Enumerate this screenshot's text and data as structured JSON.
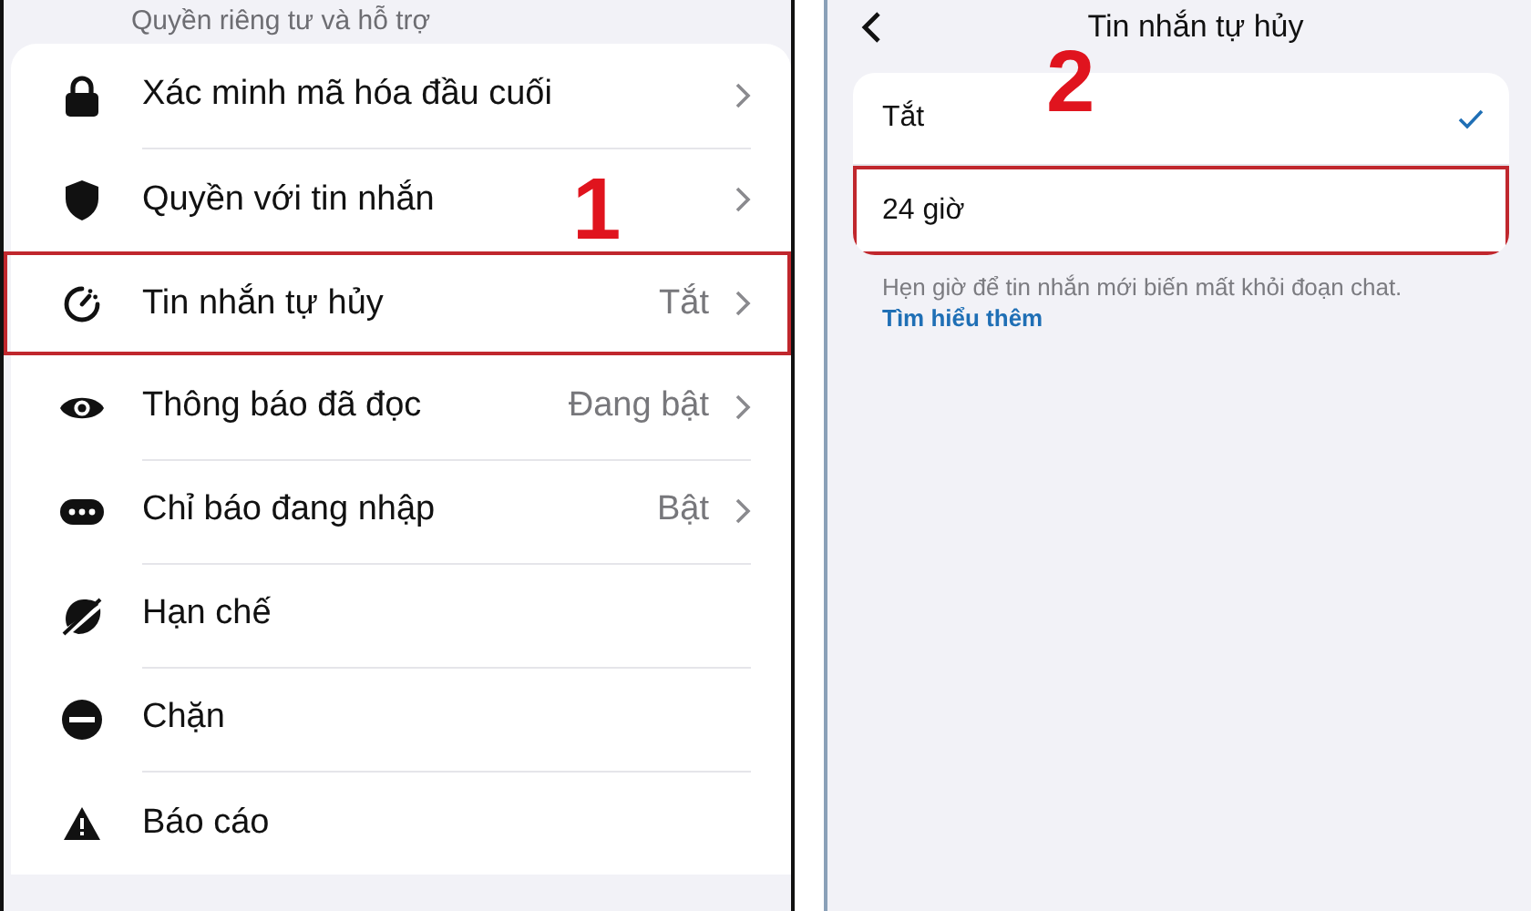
{
  "settings_screen": {
    "section_title": "Quyền riêng tư và hỗ trợ",
    "items": [
      {
        "kind": "lock",
        "label": "Xác minh mã hóa đầu cuối",
        "chevron": true,
        "highlighted": false
      },
      {
        "kind": "shield",
        "label": "Quyền với tin nhắn",
        "chevron": true,
        "highlighted": false
      },
      {
        "kind": "timer",
        "label": "Tin nhắn tự hủy",
        "value": "Tắt",
        "chevron": true,
        "highlighted": true
      },
      {
        "kind": "eye",
        "label": "Thông báo đã đọc",
        "value": "Đang bật",
        "chevron": true,
        "highlighted": false
      },
      {
        "kind": "dots",
        "label": "Chỉ báo đang nhập",
        "value": "Bật",
        "chevron": true,
        "highlighted": false
      },
      {
        "kind": "restrict",
        "label": "Hạn chế",
        "chevron": false,
        "highlighted": false
      },
      {
        "kind": "block",
        "label": "Chặn",
        "chevron": false,
        "highlighted": false
      },
      {
        "kind": "report",
        "label": "Báo cáo",
        "chevron": false,
        "highlighted": false
      }
    ],
    "annotation": "1"
  },
  "timer_screen": {
    "title": "Tin nhắn tự hủy",
    "options": [
      {
        "label": "Tắt",
        "selected": true,
        "highlighted": false
      },
      {
        "label": "24 giờ",
        "selected": false,
        "highlighted": true
      }
    ],
    "note": "Hẹn giờ để tin nhắn mới biến mất khỏi đoạn chat.",
    "link": "Tìm hiểu thêm",
    "annotation": "2"
  }
}
